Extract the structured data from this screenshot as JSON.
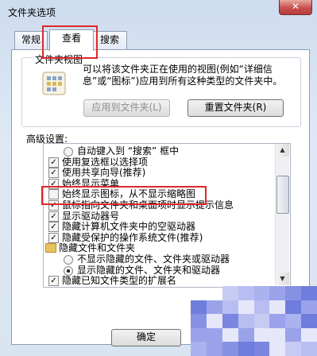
{
  "window": {
    "title": "文件夹选项",
    "close_glyph": "✕"
  },
  "tabs": [
    {
      "label": "常规"
    },
    {
      "label": "查看"
    },
    {
      "label": "搜索"
    }
  ],
  "folder_views": {
    "title": "文件夹视图",
    "description": "可以将该文件夹正在使用的视图(例如“详细信息”或“图标”)应用到所有这种类型的文件夹中。",
    "apply_button": "应用到文件夹(L)",
    "reset_button": "重置文件夹(R)"
  },
  "advanced": {
    "label": "高级设置:",
    "items": [
      {
        "type": "radio",
        "checked": false,
        "label": "自动键入到 “搜索” 框中",
        "indent": 2
      },
      {
        "type": "checkbox",
        "checked": true,
        "label": "使用复选框以选择项",
        "indent": 1
      },
      {
        "type": "checkbox",
        "checked": true,
        "label": "使用共享向导(推荐)",
        "indent": 1
      },
      {
        "type": "checkbox",
        "checked": true,
        "label": "始终显示菜单",
        "indent": 1
      },
      {
        "type": "checkbox",
        "checked": false,
        "label": "始终显示图标，从不显示缩略图",
        "indent": 1
      },
      {
        "type": "checkbox",
        "checked": true,
        "label": "鼠标指向文件夹和桌面项时显示提示信息",
        "indent": 1
      },
      {
        "type": "checkbox",
        "checked": true,
        "label": "显示驱动器号",
        "indent": 1
      },
      {
        "type": "checkbox",
        "checked": true,
        "label": "隐藏计算机文件夹中的空驱动器",
        "indent": 1
      },
      {
        "type": "checkbox",
        "checked": true,
        "label": "隐藏受保护的操作系统文件(推荐)",
        "indent": 1
      },
      {
        "type": "folder",
        "checked": false,
        "label": "隐藏文件和文件夹",
        "indent": 0
      },
      {
        "type": "radio",
        "checked": false,
        "label": "不显示隐藏的文件、文件夹或驱动器",
        "indent": 2
      },
      {
        "type": "radio",
        "checked": true,
        "label": "显示隐藏的文件、文件夹和驱动器",
        "indent": 2
      },
      {
        "type": "checkbox",
        "checked": true,
        "label": "隐藏已知文件类型的扩展名",
        "indent": 1
      }
    ]
  },
  "footer": {
    "ok_button": "确定"
  },
  "colors": {
    "annotation": "#e0262a",
    "mosaic_base": "#7a86e0"
  }
}
